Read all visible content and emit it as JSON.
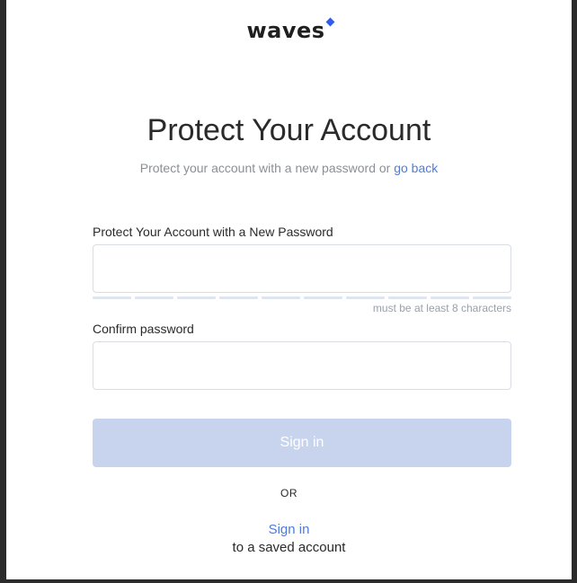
{
  "logo": {
    "text": "waves"
  },
  "page": {
    "title": "Protect Your Account",
    "subtitle_prefix": "Protect your account with a new password or",
    "subtitle_link": "go back"
  },
  "form": {
    "password": {
      "label": "Protect Your Account with a New Password",
      "value": "",
      "hint": "must be at least 8 characters",
      "strength_segments": 10,
      "strength_filled": 0
    },
    "confirm": {
      "label": "Confirm password",
      "value": ""
    },
    "submit_label": "Sign in"
  },
  "footer": {
    "or": "OR",
    "signin_link": "Sign in",
    "saved_account": "to a saved account"
  },
  "colors": {
    "accent": "#4f7bdc",
    "logo_mark": "#2f5bf5",
    "button_disabled": "#c8d4ee"
  }
}
